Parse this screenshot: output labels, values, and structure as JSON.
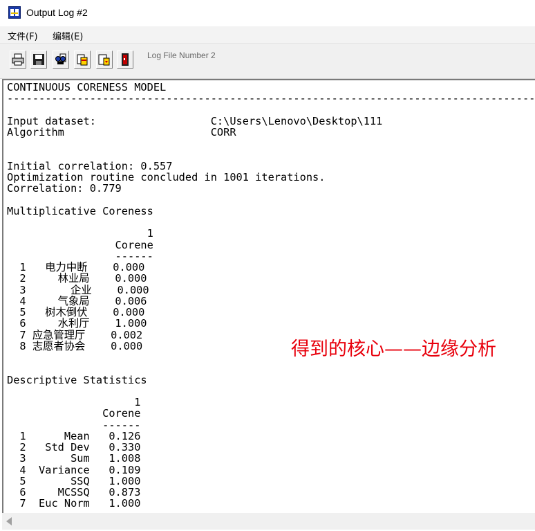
{
  "window": {
    "title": "Output Log #2",
    "icon": "ucinet-app-icon"
  },
  "menu": [
    {
      "label": "文件(F)"
    },
    {
      "label": "编辑(E)"
    }
  ],
  "toolbar": {
    "buttons": [
      {
        "icon": "print-icon"
      },
      {
        "icon": "save-icon"
      },
      {
        "icon": "find-icon"
      },
      {
        "icon": "copy-to-clipboard-icon"
      },
      {
        "icon": "export-icon"
      },
      {
        "icon": "exit-icon"
      }
    ],
    "label": "Log File Number 2"
  },
  "log": {
    "lines": [
      "CONTINUOUS CORENESS MODEL",
      "--------------------------------------------------------------------------------------",
      "",
      "Input dataset:                  C:\\Users\\Lenovo\\Desktop\\111",
      "Algorithm                       CORR",
      "",
      "",
      "Initial correlation: 0.557",
      "Optimization routine concluded in 1001 iterations.",
      "Correlation: 0.779",
      "",
      "Multiplicative Coreness",
      "",
      "                      1",
      "                 Corene",
      "                 ------",
      "  1   电力中断    0.000",
      "  2     林业局    0.000",
      "  3       企业    0.000",
      "  4     气象局    0.006",
      "  5   树木倒伏    0.000",
      "  6     水利厅    1.000",
      "  7 应急管理厅    0.002",
      "  8 志愿者协会    0.000",
      "",
      "",
      "Descriptive Statistics",
      "",
      "                    1",
      "               Corene",
      "               ------",
      "  1      Mean   0.126",
      "  2   Std Dev   0.330",
      "  3       Sum   1.008",
      "  4  Variance   0.109",
      "  5       SSQ   1.000",
      "  6     MCSSQ   0.873",
      "  7  Euc Norm   1.000"
    ]
  },
  "annotation": {
    "text": "得到的核心——边缘分析",
    "color": "#e8000c"
  },
  "scrollbar": {
    "icon": "scroll-left-arrow-icon"
  }
}
